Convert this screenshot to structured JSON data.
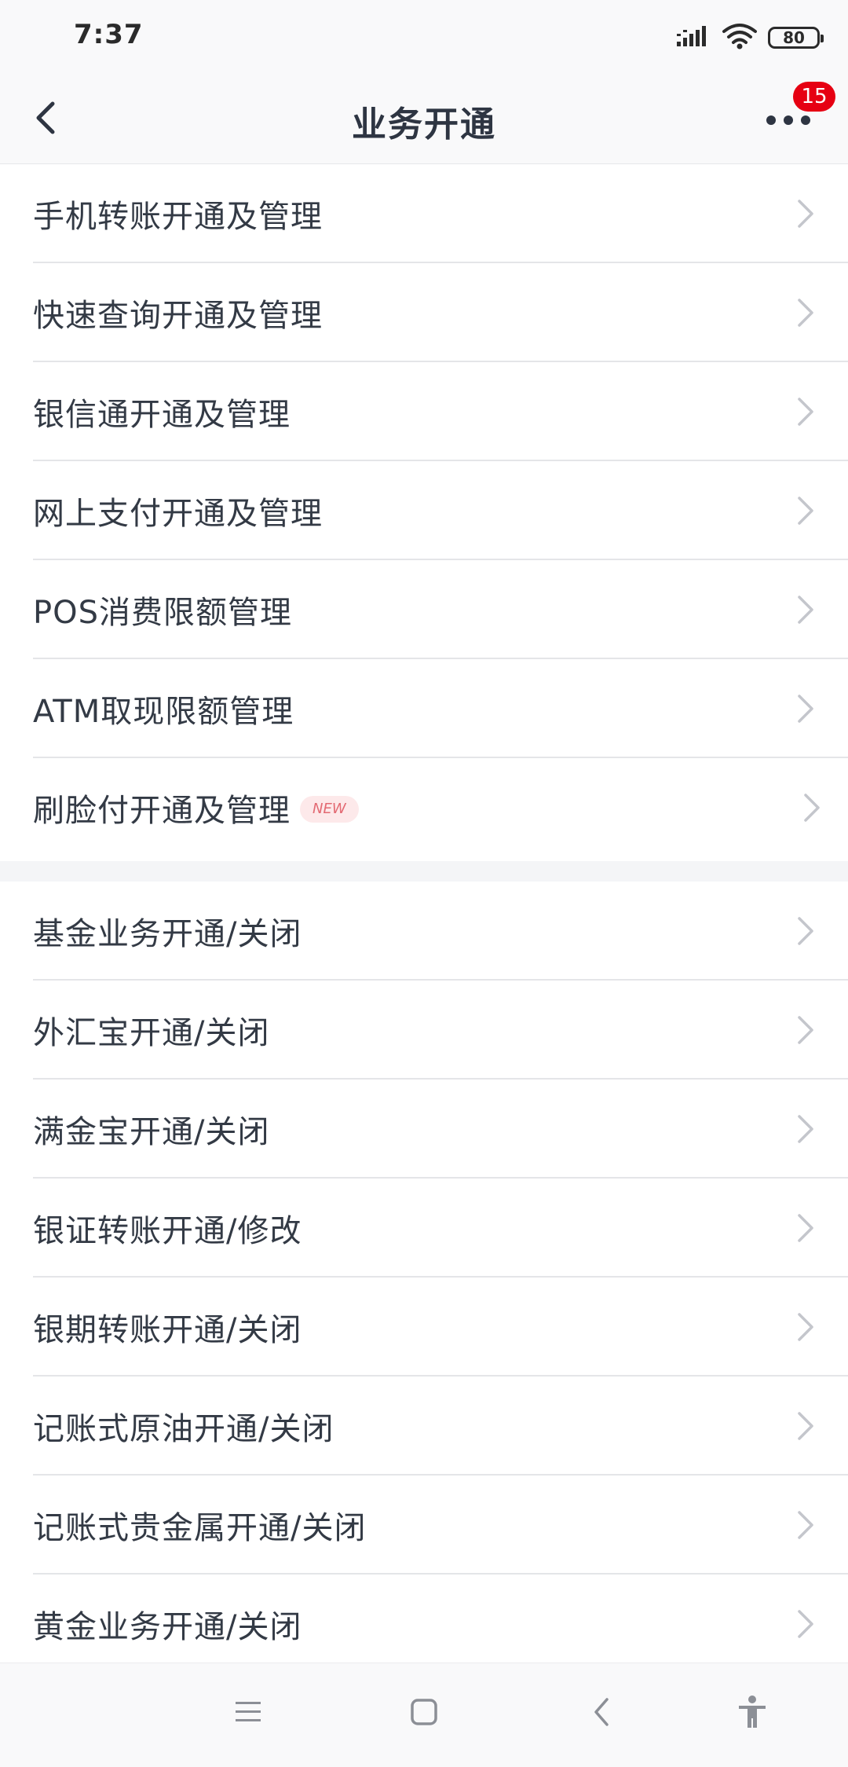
{
  "status_bar": {
    "time": "7:37",
    "battery": "80",
    "icons": [
      "signal-icon",
      "wifi-icon",
      "battery-icon"
    ]
  },
  "nav": {
    "title": "业务开通",
    "badge_count": "15",
    "icons": [
      "back-arrow-icon",
      "more-icon"
    ]
  },
  "groups": [
    {
      "items": [
        {
          "label": "手机转账开通及管理"
        },
        {
          "label": "快速查询开通及管理"
        },
        {
          "label": "银信通开通及管理"
        },
        {
          "label": "网上支付开通及管理"
        },
        {
          "label": "POS消费限额管理"
        },
        {
          "label": "ATM取现限额管理"
        },
        {
          "label": "刷脸付开通及管理",
          "tag": "NEW"
        }
      ]
    },
    {
      "items": [
        {
          "label": "基金业务开通/关闭"
        },
        {
          "label": "外汇宝开通/关闭"
        },
        {
          "label": "满金宝开通/关闭"
        },
        {
          "label": "银证转账开通/修改"
        },
        {
          "label": "银期转账开通/关闭"
        },
        {
          "label": "记账式原油开通/关闭"
        },
        {
          "label": "记账式贵金属开通/关闭"
        },
        {
          "label": "黄金业务开通/关闭"
        }
      ]
    }
  ],
  "system_nav": {
    "icons": [
      "menu-icon",
      "home-icon",
      "back-icon",
      "accessibility-icon"
    ]
  },
  "colors": {
    "badge": "#e60012",
    "text": "#333a45",
    "chevron": "#c4c6cc",
    "new_tag_bg": "#fde9ea",
    "new_tag_text": "#e36a73"
  }
}
